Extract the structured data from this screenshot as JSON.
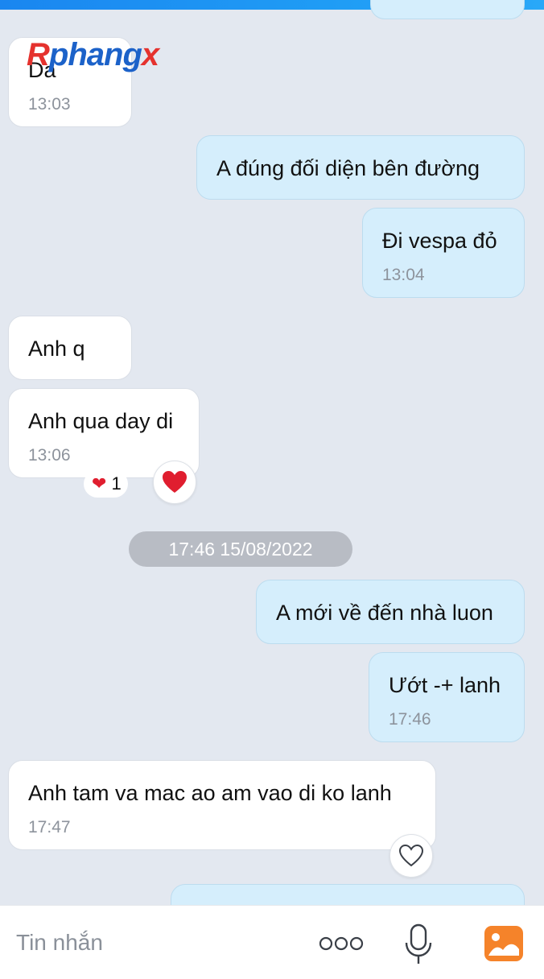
{
  "watermark": "Rphangx",
  "messages": [
    {
      "id": "m0",
      "direction": "out",
      "text": "",
      "time": ""
    },
    {
      "id": "m1",
      "direction": "in",
      "text": "Da",
      "time": "13:03"
    },
    {
      "id": "m2",
      "direction": "out",
      "text": "A đúng đối diện bên đường",
      "time": ""
    },
    {
      "id": "m3",
      "direction": "out",
      "text": "Đi vespa đỏ",
      "time": "13:04"
    },
    {
      "id": "m4",
      "direction": "in",
      "text": "Anh q",
      "time": ""
    },
    {
      "id": "m5",
      "direction": "in",
      "text": "Anh qua day di",
      "time": "13:06",
      "reaction_count": "1"
    },
    {
      "id": "m6",
      "direction": "out",
      "text": "A mới về đến nhà luon",
      "time": ""
    },
    {
      "id": "m7",
      "direction": "out",
      "text": "Ướt -+ lanh",
      "time": "17:46"
    },
    {
      "id": "m8",
      "direction": "in",
      "text": "Anh tam va mac ao am vao di ko lanh",
      "time": "17:47"
    }
  ],
  "date_separator": "17:46 15/08/2022",
  "composer": {
    "placeholder": "Tin nhắn",
    "icons": [
      "more-icon",
      "microphone-icon",
      "image-icon"
    ]
  },
  "colors": {
    "background": "#e3e8f0",
    "incoming_bubble": "#ffffff",
    "outgoing_bubble": "#d5eefc",
    "heart": "#e01e2f",
    "image_icon": "#f5832a"
  }
}
